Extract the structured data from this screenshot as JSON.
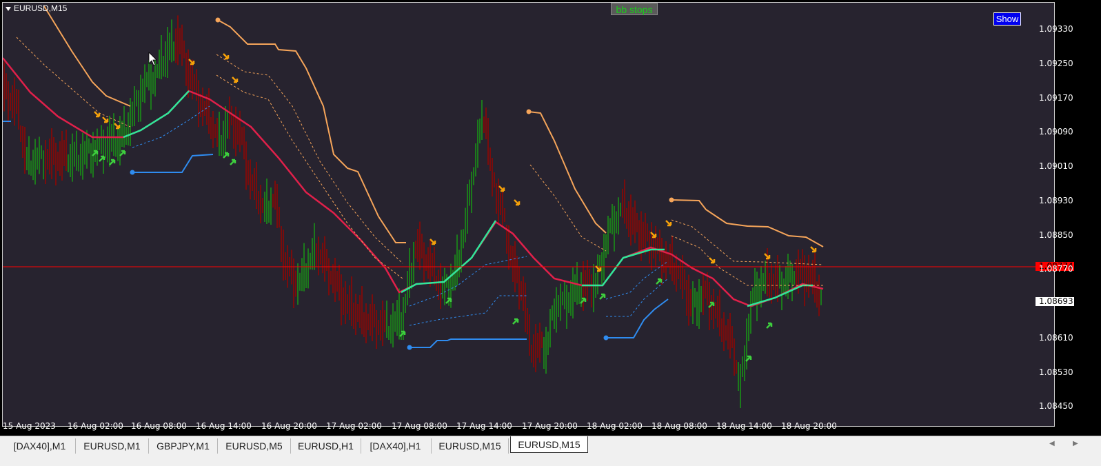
{
  "window": {
    "symbol_title": "EURUSD,M15"
  },
  "overlay": {
    "bb_stops_label": "bb stops",
    "show_button_label": "Show"
  },
  "price_axis": {
    "labels": [
      "1.09330",
      "1.09250",
      "1.09170",
      "1.09090",
      "1.09010",
      "1.08930",
      "1.08850",
      "1.08770",
      "1.08693",
      "1.08610",
      "1.08530",
      "1.08450"
    ],
    "current_price": "1.08774",
    "marker_price": "1.08693",
    "current_price_color": "#ff0000"
  },
  "time_axis": {
    "labels": [
      "15 Aug 2023",
      "16 Aug 02:00",
      "16 Aug 08:00",
      "16 Aug 14:00",
      "16 Aug 20:00",
      "17 Aug 02:00",
      "17 Aug 08:00",
      "17 Aug 14:00",
      "17 Aug 20:00",
      "18 Aug 02:00",
      "18 Aug 08:00",
      "18 Aug 14:00",
      "18 Aug 20:00"
    ]
  },
  "tabs": [
    {
      "label": "[DAX40],M1"
    },
    {
      "label": "EURUSD,M1"
    },
    {
      "label": "GBPJPY,M1"
    },
    {
      "label": "EURUSD,M5"
    },
    {
      "label": "EURUSD,H1"
    },
    {
      "label": "[DAX40],H1"
    },
    {
      "label": "EURUSD,M15"
    },
    {
      "label": "EURUSD,M15",
      "active": true
    }
  ],
  "colors": {
    "background": "#27232f",
    "bull_candle": "#1c7a1c",
    "bear_candle": "#7a0c0c",
    "ma_up": "#2ee89a",
    "ma_down": "#e0204a",
    "upper_stop": "#f6a55a",
    "lower_stop": "#2f8cf0",
    "buy_arrow": "#3ecf3e",
    "sell_arrow": "#f5a10a"
  },
  "icons": [
    "dropdown-triangle-icon",
    "buy-arrow-icon",
    "sell-arrow-icon",
    "mouse-cursor-icon",
    "scroll-left-icon",
    "scroll-right-icon"
  ]
}
